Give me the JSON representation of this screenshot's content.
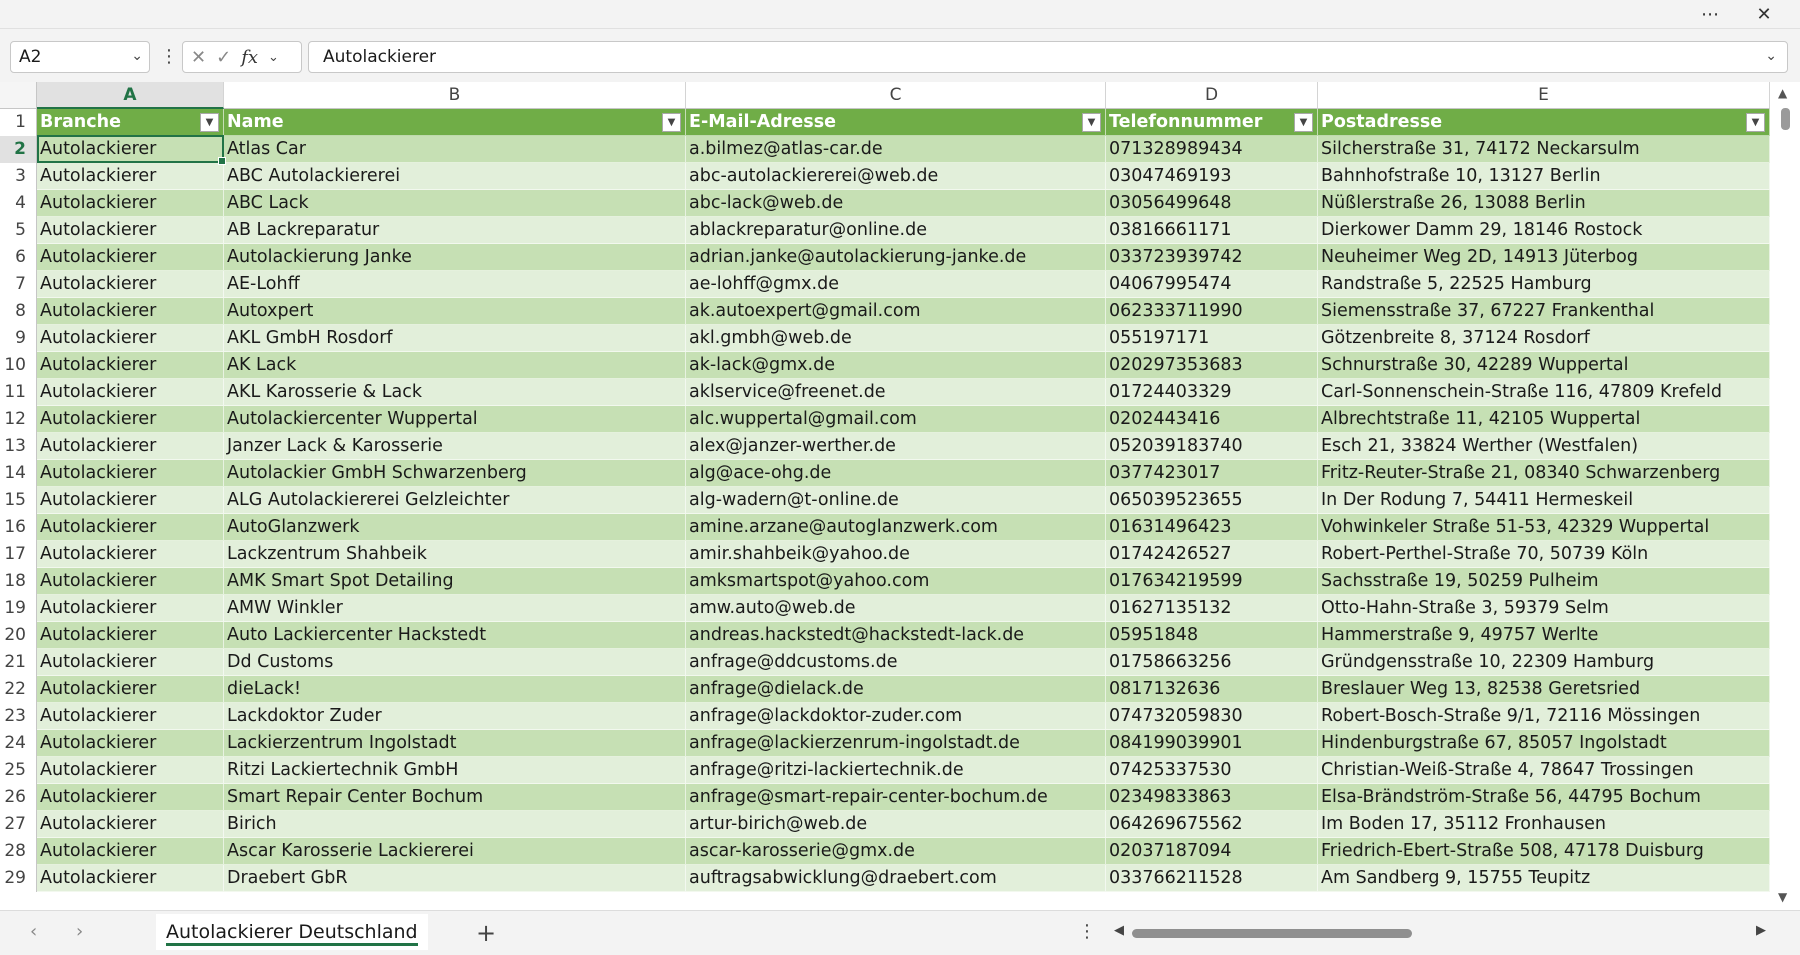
{
  "window": {
    "more_icon": "more-horizontal-icon",
    "close_icon": "close-icon"
  },
  "formula_bar": {
    "name_box": "A2",
    "formula": "Autolackierer"
  },
  "columns": [
    {
      "letter": "A",
      "header": "Branche"
    },
    {
      "letter": "B",
      "header": "Name"
    },
    {
      "letter": "C",
      "header": "E-Mail-Adresse"
    },
    {
      "letter": "D",
      "header": "Telefonnummer"
    },
    {
      "letter": "E",
      "header": "Postadresse"
    }
  ],
  "rows": [
    {
      "n": "2",
      "a": "Autolackierer",
      "b": "Atlas Car",
      "c": "a.bilmez@atlas-car.de",
      "d": "071328989434",
      "e": "Silcherstraße 31, 74172 Neckarsulm"
    },
    {
      "n": "3",
      "a": "Autolackierer",
      "b": "ABC Autolackiererei",
      "c": "abc-autolackiererei@web.de",
      "d": "03047469193",
      "e": "Bahnhofstraße 10, 13127 Berlin"
    },
    {
      "n": "4",
      "a": "Autolackierer",
      "b": "ABC Lack",
      "c": "abc-lack@web.de",
      "d": "03056499648",
      "e": "Nüßlerstraße 26, 13088 Berlin"
    },
    {
      "n": "5",
      "a": "Autolackierer",
      "b": "AB Lackreparatur",
      "c": "ablackreparatur@online.de",
      "d": "03816661171",
      "e": "Dierkower Damm 29, 18146 Rostock"
    },
    {
      "n": "6",
      "a": "Autolackierer",
      "b": "Autolackierung Janke",
      "c": "adrian.janke@autolackierung-janke.de",
      "d": "033723939742",
      "e": "Neuheimer Weg 2D, 14913 Jüterbog"
    },
    {
      "n": "7",
      "a": "Autolackierer",
      "b": "AE-Lohff",
      "c": "ae-lohff@gmx.de",
      "d": "04067995474",
      "e": "Randstraße 5, 22525 Hamburg"
    },
    {
      "n": "8",
      "a": "Autolackierer",
      "b": "Autoxpert",
      "c": "ak.autoexpert@gmail.com",
      "d": "062333711990",
      "e": "Siemensstraße 37, 67227 Frankenthal"
    },
    {
      "n": "9",
      "a": "Autolackierer",
      "b": "AKL GmbH Rosdorf",
      "c": "akl.gmbh@web.de",
      "d": "055197171",
      "e": "Götzenbreite 8, 37124 Rosdorf"
    },
    {
      "n": "10",
      "a": "Autolackierer",
      "b": "AK Lack",
      "c": "ak-lack@gmx.de",
      "d": "020297353683",
      "e": "Schnurstraße 30, 42289 Wuppertal"
    },
    {
      "n": "11",
      "a": "Autolackierer",
      "b": "AKL Karosserie & Lack",
      "c": "aklservice@freenet.de",
      "d": "01724403329",
      "e": "Carl-Sonnenschein-Straße 116, 47809 Krefeld"
    },
    {
      "n": "12",
      "a": "Autolackierer",
      "b": "Autolackiercenter Wuppertal",
      "c": "alc.wuppertal@gmail.com",
      "d": "0202443416",
      "e": "Albrechtstraße 11, 42105 Wuppertal"
    },
    {
      "n": "13",
      "a": "Autolackierer",
      "b": "Janzer Lack & Karosserie",
      "c": "alex@janzer-werther.de",
      "d": "052039183740",
      "e": "Esch 21, 33824 Werther (Westfalen)"
    },
    {
      "n": "14",
      "a": "Autolackierer",
      "b": "Autolackier GmbH Schwarzenberg",
      "c": "alg@ace-ohg.de",
      "d": "0377423017",
      "e": "Fritz-Reuter-Straße 21, 08340 Schwarzenberg"
    },
    {
      "n": "15",
      "a": "Autolackierer",
      "b": "ALG Autolackiererei Gelzleichter",
      "c": "alg-wadern@t-online.de",
      "d": "065039523655",
      "e": "In Der Rodung 7, 54411 Hermeskeil"
    },
    {
      "n": "16",
      "a": "Autolackierer",
      "b": "AutoGlanzwerk",
      "c": "amine.arzane@autoglanzwerk.com",
      "d": "01631496423",
      "e": "Vohwinkeler Straße 51-53, 42329 Wuppertal"
    },
    {
      "n": "17",
      "a": "Autolackierer",
      "b": "Lackzentrum Shahbeik",
      "c": "amir.shahbeik@yahoo.de",
      "d": "01742426527",
      "e": "Robert-Perthel-Straße 70, 50739 Köln"
    },
    {
      "n": "18",
      "a": "Autolackierer",
      "b": "AMK Smart Spot Detailing",
      "c": "amksmartspot@yahoo.com",
      "d": "017634219599",
      "e": "Sachsstraße 19, 50259 Pulheim"
    },
    {
      "n": "19",
      "a": "Autolackierer",
      "b": "AMW Winkler",
      "c": "amw.auto@web.de",
      "d": "01627135132",
      "e": "Otto-Hahn-Straße 3, 59379 Selm"
    },
    {
      "n": "20",
      "a": "Autolackierer",
      "b": "Auto Lackiercenter Hackstedt",
      "c": "andreas.hackstedt@hackstedt-lack.de",
      "d": "05951848",
      "e": "Hammerstraße 9, 49757 Werlte"
    },
    {
      "n": "21",
      "a": "Autolackierer",
      "b": "Dd Customs",
      "c": "anfrage@ddcustoms.de",
      "d": "01758663256",
      "e": "Gründgensstraße 10, 22309 Hamburg"
    },
    {
      "n": "22",
      "a": "Autolackierer",
      "b": "dieLack!",
      "c": "anfrage@dielack.de",
      "d": "0817132636",
      "e": "Breslauer Weg 13, 82538 Geretsried"
    },
    {
      "n": "23",
      "a": "Autolackierer",
      "b": "Lackdoktor Zuder",
      "c": "anfrage@lackdoktor-zuder.com",
      "d": "074732059830",
      "e": "Robert-Bosch-Straße 9/1, 72116 Mössingen"
    },
    {
      "n": "24",
      "a": "Autolackierer",
      "b": "Lackierzentrum Ingolstadt",
      "c": "anfrage@lackierzenrum-ingolstadt.de",
      "d": "084199039901",
      "e": "Hindenburgstraße 67, 85057 Ingolstadt"
    },
    {
      "n": "25",
      "a": "Autolackierer",
      "b": "Ritzi Lackiertechnik GmbH",
      "c": "anfrage@ritzi-lackiertechnik.de",
      "d": "07425337530",
      "e": "Christian-Weiß-Straße 4, 78647 Trossingen"
    },
    {
      "n": "26",
      "a": "Autolackierer",
      "b": "Smart Repair Center Bochum",
      "c": "anfrage@smart-repair-center-bochum.de",
      "d": "02349833863",
      "e": "Elsa-Brändström-Straße 56, 44795 Bochum"
    },
    {
      "n": "27",
      "a": "Autolackierer",
      "b": "Birich",
      "c": "artur-birich@web.de",
      "d": "064269675562",
      "e": "Im Boden 17, 35112 Fronhausen"
    },
    {
      "n": "28",
      "a": "Autolackierer",
      "b": "Ascar Karosserie Lackiererei",
      "c": "ascar-karosserie@gmx.de",
      "d": "02037187094",
      "e": "Friedrich-Ebert-Straße 508, 47178 Duisburg"
    },
    {
      "n": "29",
      "a": "Autolackierer",
      "b": "Draebert GbR",
      "c": "auftragsabwicklung@draebert.com",
      "d": "033766211528",
      "e": "Am Sandberg 9, 15755 Teupitz"
    }
  ],
  "sheet_tabs": [
    "Autolackierer Deutschland"
  ]
}
